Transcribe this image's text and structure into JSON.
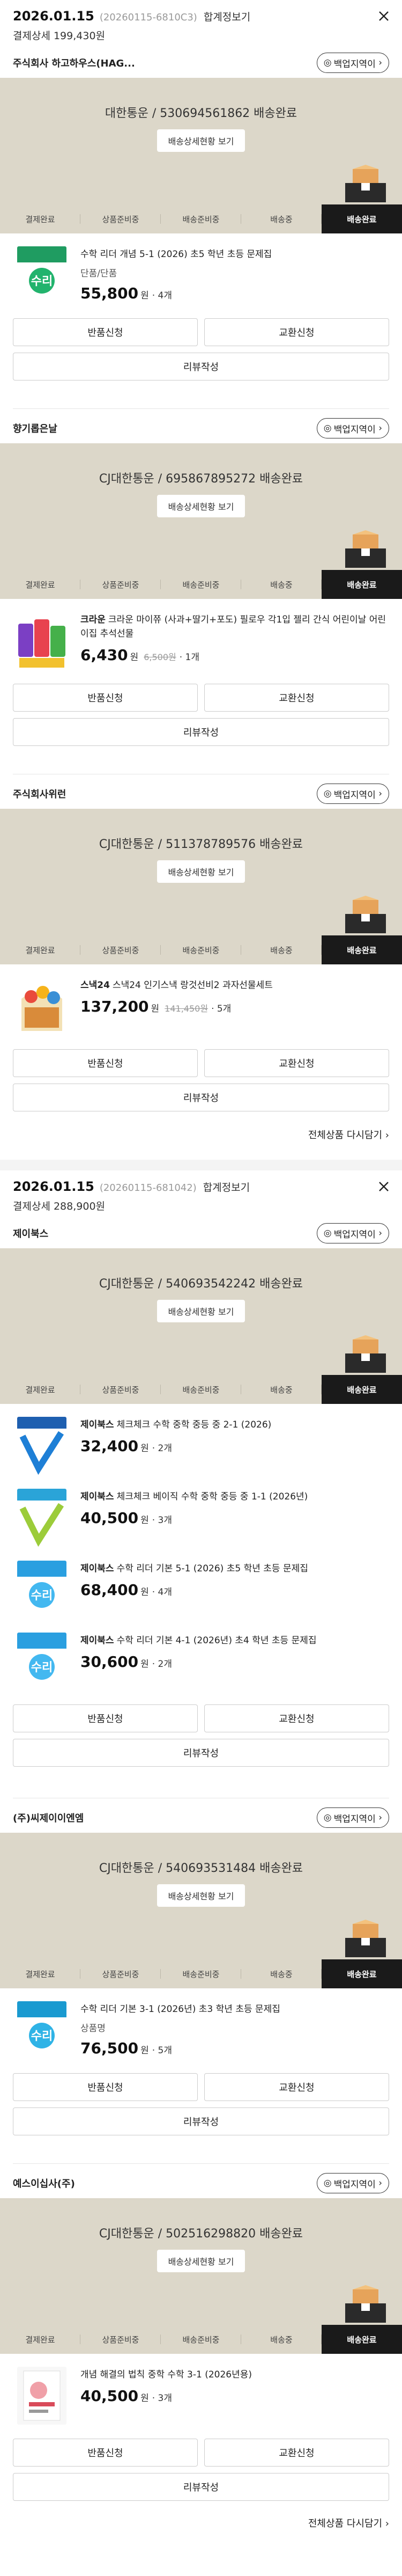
{
  "ui": {
    "detail_link": "합계정보기",
    "ask_label": "백업지역이",
    "track_label": "배송상세현황 보기",
    "return_label": "반품신청",
    "exchange_label": "교환신청",
    "review_label": "리뷰작성",
    "won": "원",
    "more_label": "전체상품 다시담기",
    "steps": [
      "결제완료",
      "상품준비중",
      "배송준비중",
      "배송중",
      "배송완료"
    ],
    "active_step_index": 4
  },
  "orders": [
    {
      "date": "2026.01.15",
      "order_no": "(20260115-6810C3)",
      "total": "결제상세 199,430원",
      "groups": [
        {
          "seller": "주식회사 하고하우스(HAG...",
          "shipping": "대한통운 / 530694561862 배송완료",
          "products": [
            {
              "name": "수학 리더 개념 5-1 (2026) 초5 학년 초등 문제집",
              "brand": "",
              "option": "단품/단품",
              "price": "55,800",
              "orig": "",
              "qty": "· 4개",
              "thumb": "book-green"
            }
          ]
        },
        {
          "seller": "향기롭은날",
          "shipping": "CJ대한통운 / 695867895272 배송완료",
          "products": [
            {
              "name": "크라운 마이쮸 (사과+딸기+포도) 필로우 각1입 젤리 간식 어린이날 어린이집 추석선물",
              "brand": "크라운",
              "option": "",
              "price": "6,430",
              "orig": "6,500원",
              "qty": "· 1개",
              "thumb": "candy"
            }
          ]
        },
        {
          "seller": "주식회사위런",
          "shipping": "CJ대한통운 / 511378789576 배송완료",
          "products": [
            {
              "name": "스낵24 인기스낵 랑것선비2 과자선물세트",
              "brand": "스낵24",
              "option": "",
              "price": "137,200",
              "orig": "141,450원",
              "qty": "· 5개",
              "thumb": "snack"
            }
          ]
        }
      ]
    },
    {
      "date": "2026.01.15",
      "order_no": "(20260115-681042)",
      "total": "결제상세 288,900원",
      "groups": [
        {
          "seller": "제이북스",
          "shipping": "CJ대한통운 / 540693542242 배송완료",
          "products": [
            {
              "name": "체크체크 수학 중학 중등 중 2-1 (2026)",
              "brand": "제이북스",
              "option": "",
              "price": "32,400",
              "orig": "",
              "qty": "· 2개",
              "thumb": "book-blue"
            },
            {
              "name": "체크체크 베이직 수학 중학 중등 중 1-1 (2026년)",
              "brand": "제이북스",
              "option": "",
              "price": "40,500",
              "orig": "",
              "qty": "· 3개",
              "thumb": "book-lime"
            },
            {
              "name": "수학 리더 기본 5-1 (2026) 초5 학년 초등 문제집",
              "brand": "제이북스",
              "option": "",
              "price": "68,400",
              "orig": "",
              "qty": "· 4개",
              "thumb": "book-sky"
            },
            {
              "name": "수학 리더 기본 4-1 (2026년) 초4 학년 초등 문제집",
              "brand": "제이북스",
              "option": "",
              "price": "30,600",
              "orig": "",
              "qty": "· 2개",
              "thumb": "book-sky"
            }
          ]
        },
        {
          "seller": "(주)씨제이이엔엠",
          "shipping": "CJ대한통운 / 540693531484 배송완료",
          "products": [
            {
              "name": "수학 리더 기본 3-1 (2026년) 초3 학년 초등 문제집",
              "brand": "",
              "option": "상품명",
              "price": "76,500",
              "orig": "",
              "qty": "· 5개",
              "thumb": "book-teal"
            }
          ]
        },
        {
          "seller": "예스이십사(주)",
          "shipping": "CJ대한통운 / 502516298820 배송완료",
          "products": [
            {
              "name": "개념 해결의 법칙 중학 수학 3-1 (2026년용)",
              "brand": "",
              "option": "",
              "price": "40,500",
              "orig": "",
              "qty": "· 3개",
              "thumb": "book-white"
            }
          ]
        }
      ]
    }
  ]
}
